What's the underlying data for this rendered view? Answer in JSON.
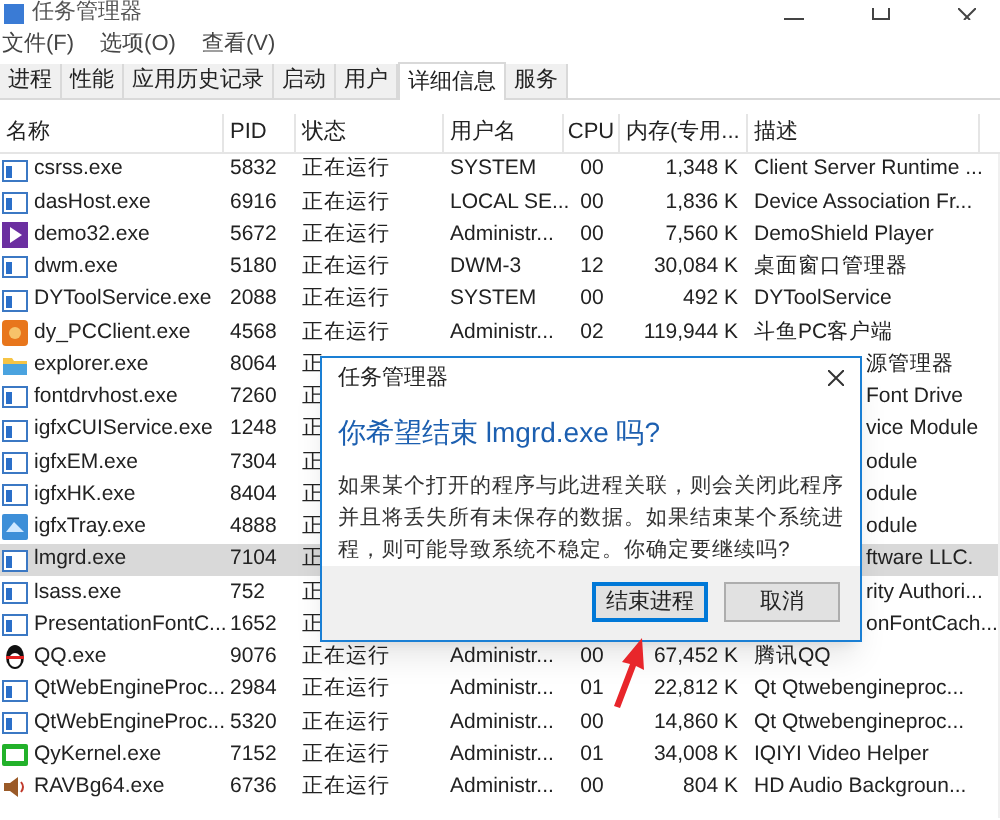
{
  "window": {
    "title": "任务管理器"
  },
  "menu": [
    "文件(F)",
    "选项(O)",
    "查看(V)"
  ],
  "tabs": [
    {
      "label": "进程",
      "selected": false
    },
    {
      "label": "性能",
      "selected": false
    },
    {
      "label": "应用历史记录",
      "selected": false
    },
    {
      "label": "启动",
      "selected": false
    },
    {
      "label": "用户",
      "selected": false
    },
    {
      "label": "详细信息",
      "selected": true
    },
    {
      "label": "服务",
      "selected": false
    }
  ],
  "columns": [
    "名称",
    "PID",
    "状态",
    "用户名",
    "CPU",
    "内存(专用...",
    "描述"
  ],
  "rows": [
    {
      "kind": "window",
      "name": "csrss.exe",
      "pid": "5832",
      "status": "正在运行",
      "user": "SYSTEM",
      "cpu": "00",
      "memory": "1,348 K",
      "description": "Client Server Runtime ...",
      "selected": false
    },
    {
      "kind": "window",
      "name": "dasHost.exe",
      "pid": "6916",
      "status": "正在运行",
      "user": "LOCAL SE...",
      "cpu": "00",
      "memory": "1,836 K",
      "description": "Device Association Fr...",
      "selected": false
    },
    {
      "kind": "play",
      "name": "demo32.exe",
      "pid": "5672",
      "status": "正在运行",
      "user": "Administr...",
      "cpu": "00",
      "memory": "7,560 K",
      "description": "DemoShield Player",
      "selected": false
    },
    {
      "kind": "window",
      "name": "dwm.exe",
      "pid": "5180",
      "status": "正在运行",
      "user": "DWM-3",
      "cpu": "12",
      "memory": "30,084 K",
      "description": "桌面窗口管理器",
      "selected": false
    },
    {
      "kind": "window",
      "name": "DYToolService.exe",
      "pid": "2088",
      "status": "正在运行",
      "user": "SYSTEM",
      "cpu": "00",
      "memory": "492 K",
      "description": "DYToolService",
      "selected": false
    },
    {
      "kind": "orange",
      "name": "dy_PCClient.exe",
      "pid": "4568",
      "status": "正在运行",
      "user": "Administr...",
      "cpu": "02",
      "memory": "119,944 K",
      "description": "斗鱼PC客户端",
      "selected": false
    },
    {
      "kind": "folder",
      "name": "explorer.exe",
      "pid": "8064",
      "status": "正",
      "description": "源管理器",
      "selected": false
    },
    {
      "kind": "window",
      "name": "fontdrvhost.exe",
      "pid": "7260",
      "status": "正",
      "description": "Font Drive",
      "selected": false
    },
    {
      "kind": "window",
      "name": "igfxCUIService.exe",
      "pid": "1248",
      "status": "正",
      "description": "vice Module",
      "selected": false
    },
    {
      "kind": "window",
      "name": "igfxEM.exe",
      "pid": "7304",
      "status": "正",
      "description": "odule",
      "selected": false
    },
    {
      "kind": "window",
      "name": "igfxHK.exe",
      "pid": "8404",
      "status": "正",
      "description": "odule",
      "selected": false
    },
    {
      "kind": "tray",
      "name": "igfxTray.exe",
      "pid": "4888",
      "status": "正",
      "description": "odule",
      "selected": false
    },
    {
      "kind": "window",
      "name": "lmgrd.exe",
      "pid": "7104",
      "status": "正",
      "description": "ftware LLC.",
      "selected": true
    },
    {
      "kind": "window",
      "name": "lsass.exe",
      "pid": "752",
      "status": "正",
      "description": "rity Authori...",
      "selected": false
    },
    {
      "kind": "window",
      "name": "PresentationFontC...",
      "pid": "1652",
      "status": "正",
      "description": "onFontCach...",
      "selected": false
    },
    {
      "kind": "penguin",
      "name": "QQ.exe",
      "pid": "9076",
      "status": "正在运行",
      "user": "Administr...",
      "cpu": "00",
      "memory": "67,452 K",
      "description": "腾讯QQ",
      "selected": false
    },
    {
      "kind": "window",
      "name": "QtWebEngineProc...",
      "pid": "2984",
      "status": "正在运行",
      "user": "Administr...",
      "cpu": "01",
      "memory": "22,812 K",
      "description": "Qt Qtwebengineproc...",
      "selected": false
    },
    {
      "kind": "window",
      "name": "QtWebEngineProc...",
      "pid": "5320",
      "status": "正在运行",
      "user": "Administr...",
      "cpu": "00",
      "memory": "14,860 K",
      "description": "Qt Qtwebengineproc...",
      "selected": false
    },
    {
      "kind": "green",
      "name": "QyKernel.exe",
      "pid": "7152",
      "status": "正在运行",
      "user": "Administr...",
      "cpu": "01",
      "memory": "34,008 K",
      "description": "IQIYI Video Helper",
      "selected": false
    },
    {
      "kind": "speaker",
      "name": "RAVBg64.exe",
      "pid": "6736",
      "status": "正在运行",
      "user": "Administr...",
      "cpu": "00",
      "memory": "804 K",
      "description": "HD Audio Backgroun...",
      "selected": false
    }
  ],
  "dialog": {
    "title": "任务管理器",
    "heading": "你希望结束 lmgrd.exe 吗?",
    "message": "如果某个打开的程序与此进程关联，则会关闭此程序并且将丢失所有未保存的数据。如果结束某个系统进程，则可能导致系统不稳定。你确定要继续吗?",
    "buttons": [
      {
        "label": "结束进程",
        "selected": true
      },
      {
        "label": "取消",
        "selected": false
      }
    ]
  }
}
